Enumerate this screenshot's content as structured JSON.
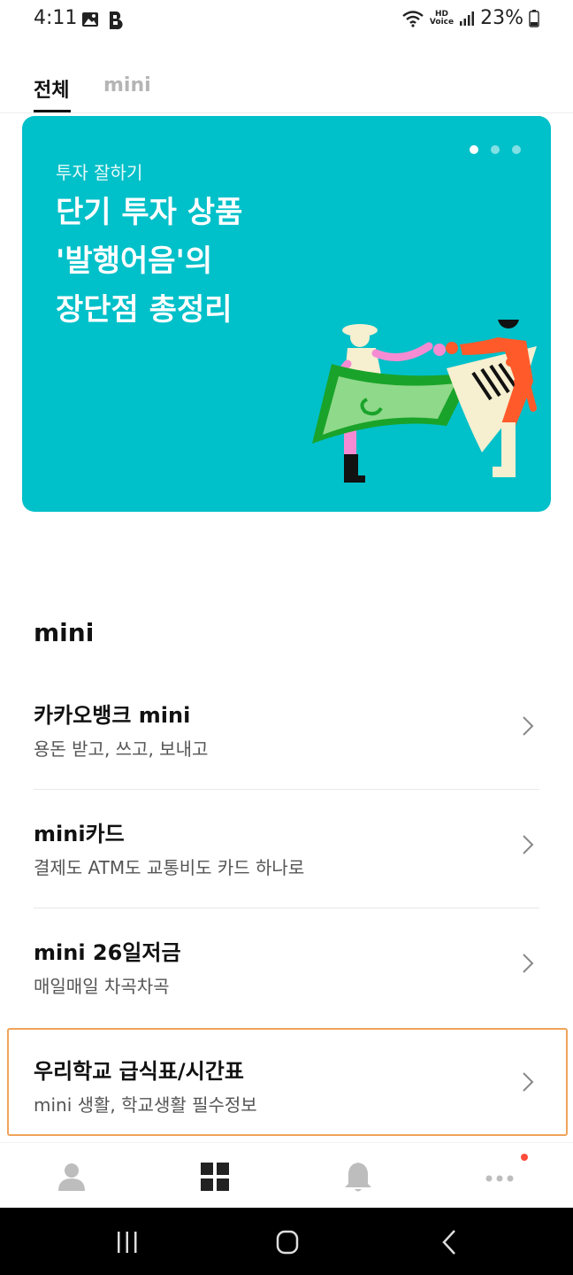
{
  "status_bar": {
    "time": "4:11",
    "battery": "23%",
    "network_label_top": "HD",
    "network_label_bottom": "Voice"
  },
  "tabs": [
    {
      "label": "전체",
      "active": true
    },
    {
      "label": "mini",
      "active": false
    }
  ],
  "banner": {
    "category": "투자 잘하기",
    "title_lines": [
      "단기 투자 상품",
      "'발행어음'의",
      "장단점 총정리"
    ],
    "page_count": 3,
    "active_index": 0,
    "background_color": "#00c0c9"
  },
  "section": {
    "title": "mini",
    "items": [
      {
        "title": "카카오뱅크 mini",
        "subtitle": "용돈 받고, 쓰고, 보내고"
      },
      {
        "title": "mini카드",
        "subtitle": "결제도 ATM도 교통비도 카드 하나로"
      },
      {
        "title": "mini 26일저금",
        "subtitle": "매일매일 차곡차곡"
      },
      {
        "title": "우리학교 급식표/시간표",
        "subtitle": "mini 생활, 학교생활 필수정보"
      }
    ]
  },
  "bottom_nav": {
    "items": [
      "person-icon",
      "grid-icon",
      "bell-icon",
      "more-icon"
    ],
    "notification_color": "#ff4c3b"
  },
  "system_nav": [
    "recents-icon",
    "home-icon",
    "back-icon"
  ]
}
